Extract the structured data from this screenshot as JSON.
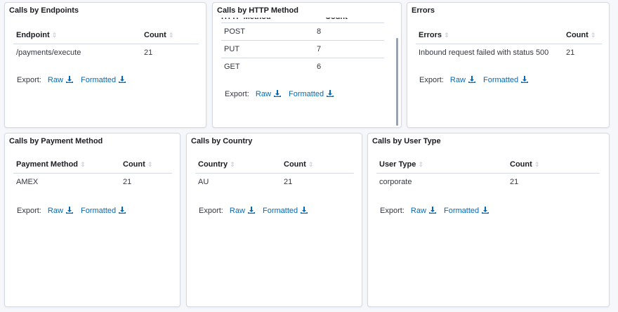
{
  "panels": {
    "endpoints": {
      "title": "Calls by Endpoints",
      "headers": [
        "Endpoint",
        "Count"
      ],
      "rows": [
        [
          "/payments/execute",
          "21"
        ]
      ]
    },
    "http_method": {
      "title": "Calls by HTTP Method",
      "headers": [
        "HTTP Method",
        "Count"
      ],
      "rows": [
        [
          "POST",
          "8"
        ],
        [
          "PUT",
          "7"
        ],
        [
          "GET",
          "6"
        ]
      ]
    },
    "errors": {
      "title": "Errors",
      "headers": [
        "Errors",
        "Count"
      ],
      "rows": [
        [
          "Inbound request failed with status 500",
          "21"
        ]
      ]
    },
    "payment_method": {
      "title": "Calls by Payment Method",
      "headers": [
        "Payment Method",
        "Count"
      ],
      "rows": [
        [
          "AMEX",
          "21"
        ]
      ]
    },
    "country": {
      "title": "Calls by Country",
      "headers": [
        "Country",
        "Count"
      ],
      "rows": [
        [
          "AU",
          "21"
        ]
      ]
    },
    "user_type": {
      "title": "Calls by User Type",
      "headers": [
        "User Type",
        "Count"
      ],
      "rows": [
        [
          "corporate",
          "21"
        ]
      ]
    }
  },
  "export": {
    "label": "Export:",
    "raw": "Raw",
    "formatted": "Formatted"
  },
  "icons": {
    "sort": "sort-icon",
    "download": "download-icon"
  },
  "colors": {
    "link": "#006bb8",
    "border": "#d3dae6",
    "background": "#f5f7fa"
  }
}
